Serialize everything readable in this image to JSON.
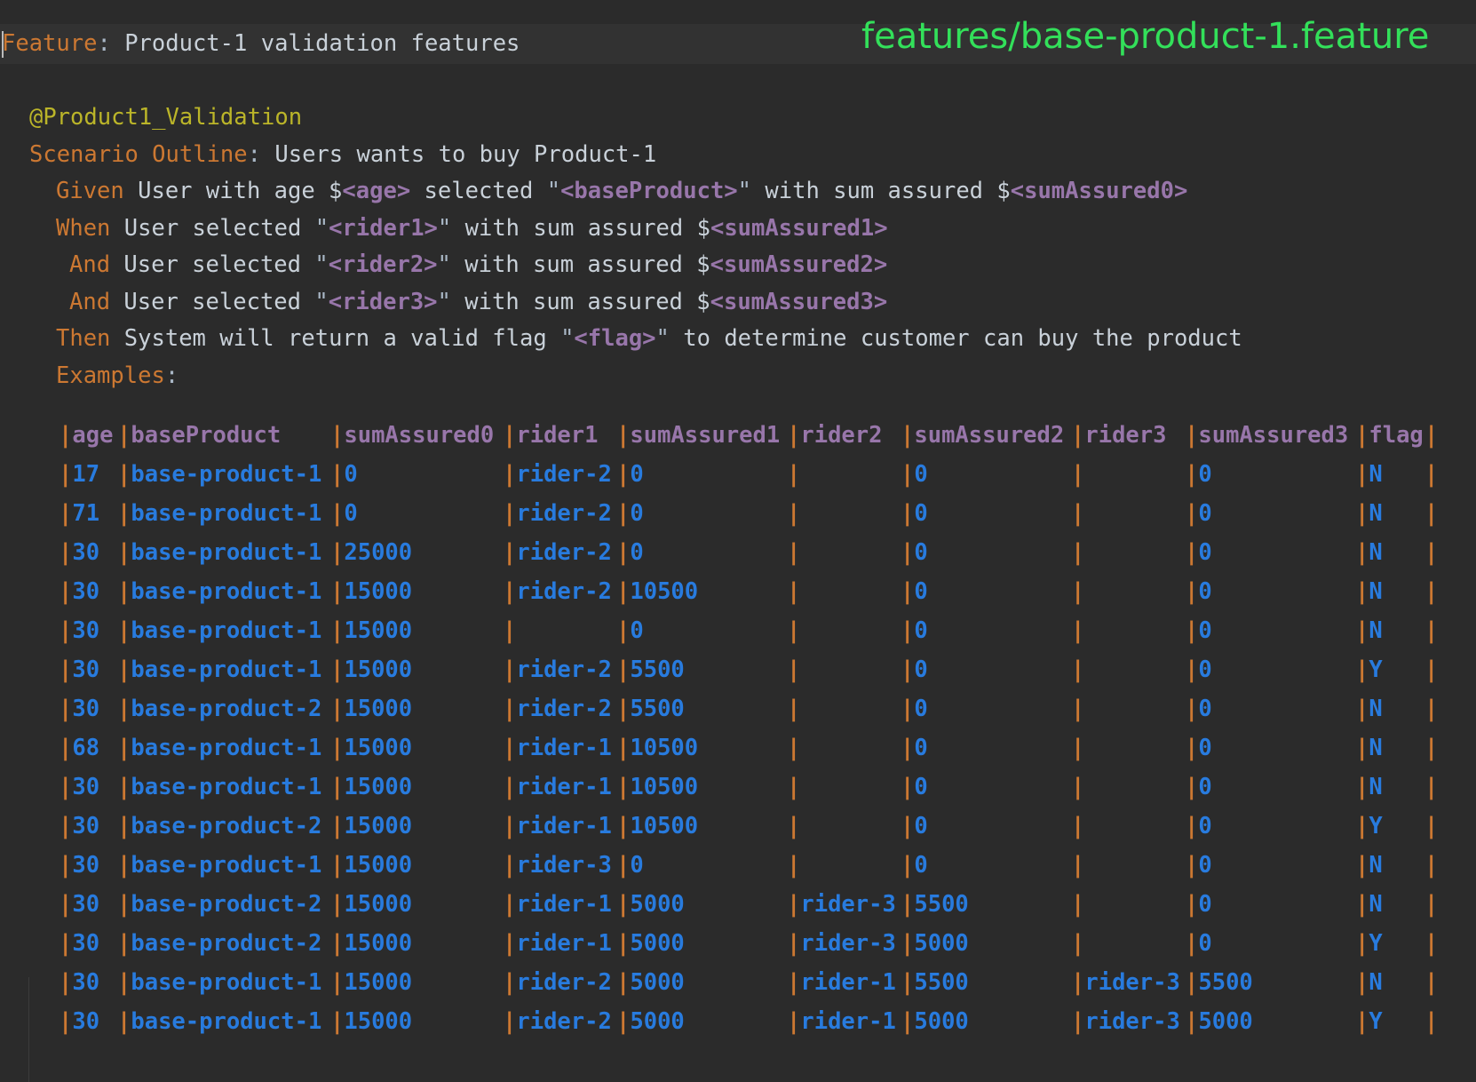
{
  "file_label": "features/base-product-1.feature",
  "feature": {
    "keyword": "Feature",
    "title": "Product-1 validation features"
  },
  "tag": "@Product1_Validation",
  "scenario": {
    "keyword": "Scenario Outline",
    "title": "Users wants to buy Product-1"
  },
  "steps": {
    "given": {
      "keyword": "Given",
      "t1": "User with age $",
      "p1": "<age>",
      "t2": " selected ",
      "p2": "<baseProduct>",
      "t3": " with sum assured $",
      "p3": "<sumAssured0>"
    },
    "when": {
      "keyword": "When",
      "t1": "User selected ",
      "p1": "<rider1>",
      "t2": " with sum assured $",
      "p2": "<sumAssured1>"
    },
    "and1": {
      "keyword": "And",
      "t1": "User selected ",
      "p1": "<rider2>",
      "t2": " with sum assured $",
      "p2": "<sumAssured2>"
    },
    "and2": {
      "keyword": "And",
      "t1": "User selected ",
      "p1": "<rider3>",
      "t2": " with sum assured $",
      "p2": "<sumAssured3>"
    },
    "then": {
      "keyword": "Then",
      "t1": "System will return a valid flag ",
      "p1": "<flag>",
      "t2": " to determine customer can buy the product"
    }
  },
  "examples_keyword": "Examples",
  "table": {
    "headers": [
      "age",
      "baseProduct",
      "sumAssured0",
      "rider1",
      "sumAssured1",
      "rider2",
      "sumAssured2",
      "rider3",
      "sumAssured3",
      "flag"
    ],
    "rows": [
      [
        "17",
        "base-product-1",
        "0",
        "rider-2",
        "0",
        "",
        "0",
        "",
        "0",
        "N"
      ],
      [
        "71",
        "base-product-1",
        "0",
        "rider-2",
        "0",
        "",
        "0",
        "",
        "0",
        "N"
      ],
      [
        "30",
        "base-product-1",
        "25000",
        "rider-2",
        "0",
        "",
        "0",
        "",
        "0",
        "N"
      ],
      [
        "30",
        "base-product-1",
        "15000",
        "rider-2",
        "10500",
        "",
        "0",
        "",
        "0",
        "N"
      ],
      [
        "30",
        "base-product-1",
        "15000",
        "",
        "0",
        "",
        "0",
        "",
        "0",
        "N"
      ],
      [
        "30",
        "base-product-1",
        "15000",
        "rider-2",
        "5500",
        "",
        "0",
        "",
        "0",
        "Y"
      ],
      [
        "30",
        "base-product-2",
        "15000",
        "rider-2",
        "5500",
        "",
        "0",
        "",
        "0",
        "N"
      ],
      [
        "68",
        "base-product-1",
        "15000",
        "rider-1",
        "10500",
        "",
        "0",
        "",
        "0",
        "N"
      ],
      [
        "30",
        "base-product-1",
        "15000",
        "rider-1",
        "10500",
        "",
        "0",
        "",
        "0",
        "N"
      ],
      [
        "30",
        "base-product-2",
        "15000",
        "rider-1",
        "10500",
        "",
        "0",
        "",
        "0",
        "Y"
      ],
      [
        "30",
        "base-product-1",
        "15000",
        "rider-3",
        "0",
        "",
        "0",
        "",
        "0",
        "N"
      ],
      [
        "30",
        "base-product-2",
        "15000",
        "rider-1",
        "5000",
        "rider-3",
        "5500",
        "",
        "0",
        "N"
      ],
      [
        "30",
        "base-product-2",
        "15000",
        "rider-1",
        "5000",
        "rider-3",
        "5000",
        "",
        "0",
        "Y"
      ],
      [
        "30",
        "base-product-1",
        "15000",
        "rider-2",
        "5000",
        "rider-1",
        "5500",
        "rider-3",
        "5500",
        "N"
      ],
      [
        "30",
        "base-product-1",
        "15000",
        "rider-2",
        "5000",
        "rider-1",
        "5000",
        "rider-3",
        "5000",
        "Y"
      ]
    ]
  }
}
